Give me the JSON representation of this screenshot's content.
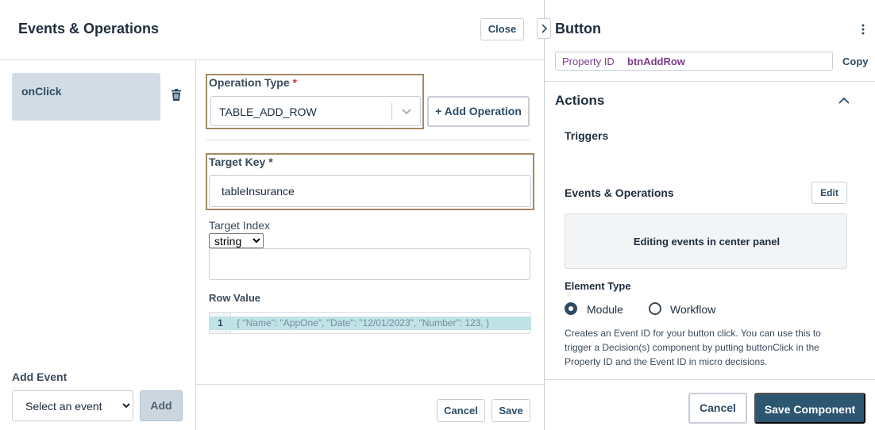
{
  "modal": {
    "title": "Events & Operations",
    "close_label": "Close"
  },
  "events": {
    "items": [
      {
        "label": "onClick",
        "selected": true
      }
    ],
    "add_event_label": "Add Event",
    "select_placeholder": "Select an event",
    "add_label": "Add"
  },
  "operation": {
    "type_label": "Operation Type",
    "required_marker": "*",
    "type_value": "TABLE_ADD_ROW",
    "add_operation_label": "+ Add Operation",
    "target_key_label": "Target Key *",
    "target_key_value": "tableInsurance",
    "target_index_label": "Target Index",
    "target_index_type": "string",
    "target_index_value": "",
    "row_value_label": "Row Value",
    "row_value_line_number": "1",
    "row_value_code": "{ \"Name\": \"AppOne\", \"Date\": \"12/01/2023\", \"Number\": 123, }",
    "cancel_label": "Cancel",
    "save_label": "Save"
  },
  "panel": {
    "title": "Button",
    "property_id_label": "Property ID",
    "property_id_value": "btnAddRow",
    "copy_label": "Copy",
    "actions_title": "Actions",
    "triggers_label": "Triggers",
    "events_ops_label": "Events & Operations",
    "edit_label": "Edit",
    "info_text": "Editing events in center panel",
    "element_type_label": "Element Type",
    "element_types": [
      {
        "label": "Module",
        "selected": true
      },
      {
        "label": "Workflow",
        "selected": false
      }
    ],
    "help_text": "Creates an Event ID for your button click. You can use this to trigger a Decision(s) component by putting buttonClick in the Property ID and the Event ID in micro decisions.",
    "cancel_label": "Cancel",
    "save_component_label": "Save Component"
  },
  "colors": {
    "primary": "#2d5671",
    "highlight_border": "#a38a63",
    "selected_event_bg": "#d3dce4",
    "property_id_text": "#7a3c8a",
    "code_highlight": "#bfe3e6",
    "required": "#d0333a"
  }
}
